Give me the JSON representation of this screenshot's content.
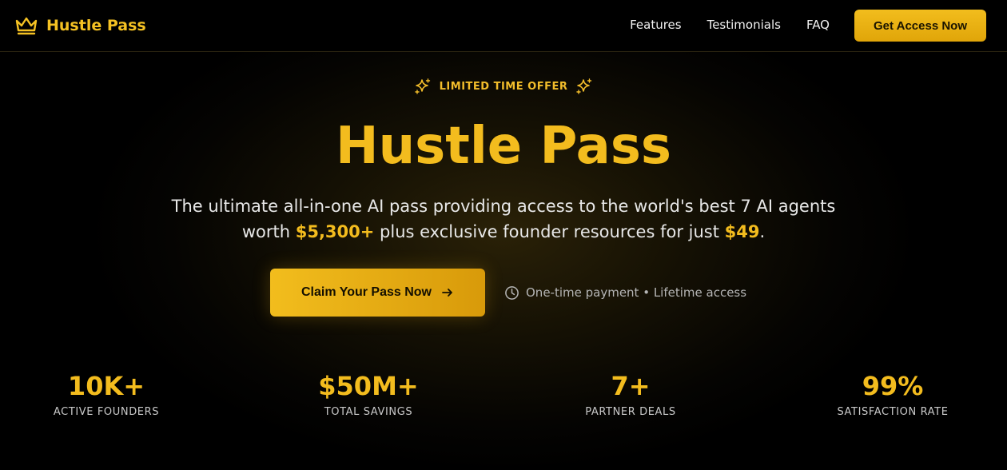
{
  "header": {
    "brand": "Hustle Pass",
    "nav": [
      {
        "label": "Features"
      },
      {
        "label": "Testimonials"
      },
      {
        "label": "FAQ"
      }
    ],
    "cta_label": "Get Access Now"
  },
  "hero": {
    "badge": "LIMITED TIME OFFER",
    "title": "Hustle Pass",
    "subtitle_line1": "The ultimate all-in-one AI pass providing access to the world's best 7 AI agents",
    "subtitle_pre": "worth ",
    "subtitle_value": "$5,300+",
    "subtitle_mid": " plus exclusive founder resources for just ",
    "subtitle_price": "$49",
    "subtitle_end": ".",
    "cta_label": "Claim Your Pass Now",
    "payment_note": "One-time payment • Lifetime access"
  },
  "stats": [
    {
      "value": "10K+",
      "label": "ACTIVE FOUNDERS"
    },
    {
      "value": "$50M+",
      "label": "TOTAL SAVINGS"
    },
    {
      "value": "7+",
      "label": "PARTNER DEALS"
    },
    {
      "value": "99%",
      "label": "SATISFACTION RATE"
    }
  ],
  "colors": {
    "accent": "#f3bc1e",
    "background": "#000000"
  },
  "icons": {
    "logo": "crown-icon",
    "badge": "sparkles-icon",
    "cta": "arrow-right-icon",
    "note": "clock-icon"
  }
}
